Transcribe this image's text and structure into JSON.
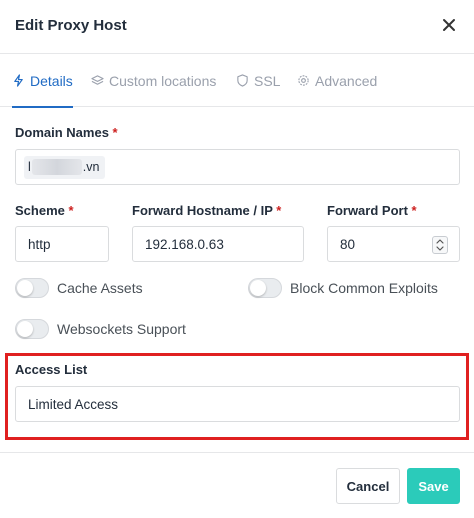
{
  "modal": {
    "title": "Edit Proxy Host",
    "close_icon": "close-icon"
  },
  "tabs": [
    {
      "label": "Details",
      "icon": "bolt-icon",
      "active": true
    },
    {
      "label": "Custom locations",
      "icon": "layers-icon",
      "active": false
    },
    {
      "label": "SSL",
      "icon": "shield-icon",
      "active": false
    },
    {
      "label": "Advanced",
      "icon": "gear-icon",
      "active": false
    }
  ],
  "domain": {
    "label": "Domain Names",
    "required_mark": "*",
    "chip_prefix": "l",
    "chip_suffix": ".vn"
  },
  "scheme": {
    "label": "Scheme",
    "required_mark": "*",
    "value": "http"
  },
  "hostname": {
    "label": "Forward Hostname / IP",
    "required_mark": "*",
    "value": "192.168.0.63"
  },
  "port": {
    "label": "Forward Port",
    "required_mark": "*",
    "value": "80"
  },
  "toggles": {
    "cache_assets": {
      "label": "Cache Assets",
      "on": false
    },
    "block_exploits": {
      "label": "Block Common Exploits",
      "on": false
    },
    "websockets": {
      "label": "Websockets Support",
      "on": false
    }
  },
  "access_list": {
    "label": "Access List",
    "value": "Limited Access"
  },
  "footer": {
    "cancel_label": "Cancel",
    "save_label": "Save"
  },
  "colors": {
    "accent": "#206bc4",
    "save": "#2bcbba",
    "highlight": "#e02020",
    "required": "#cd201f"
  }
}
